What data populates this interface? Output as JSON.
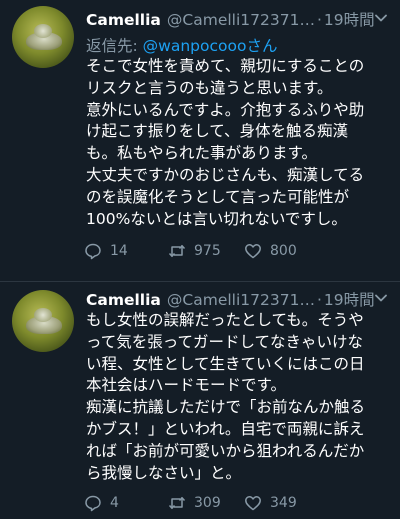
{
  "tweets": [
    {
      "display_name": "Camellia",
      "handle": "@Camelli172371…",
      "separator": "·",
      "time": "19時間",
      "reply_prefix": "返信先: ",
      "reply_mention": "@wanpocoooさん",
      "lines": [
        "そこで女性を責めて、親切にすることの",
        "リスクと言うのも違うと思います。",
        "意外にいるんですよ。介抱するふりや助",
        "け起こす振りをして、身体を触る痴漢",
        "も。私もやられた事があります。",
        "大丈夫ですかのおじさんも、痴漢してる",
        "のを誤魔化そうとして言った可能性が",
        "100%ないとは言い切れないですし。"
      ],
      "replies": "14",
      "retweets": "975",
      "likes": "800"
    },
    {
      "display_name": "Camellia",
      "handle": "@Camelli172371…",
      "separator": "·",
      "time": "19時間",
      "lines": [
        "もし女性の誤解だったとしても。そうや",
        "って気を張ってガードしてなきゃいけな",
        "い程、女性として生きていくにはこの日",
        "本社会はハードモードです。",
        "痴漢に抗議しただけで「お前なんか触る",
        "かブス！」といわれ。自宅で両親に訴え",
        "れば「お前が可愛いから狙われるんだか",
        "ら我慢しなさい」と。"
      ],
      "replies": "4",
      "retweets": "309",
      "likes": "349"
    }
  ],
  "colors": {
    "background": "#141d26",
    "text": "#ffffff",
    "secondary": "#8899a6",
    "link": "#1da1f2"
  },
  "icons": {
    "reply": "reply-icon",
    "retweet": "retweet-icon",
    "like": "heart-icon",
    "more": "chevron-down-icon"
  }
}
